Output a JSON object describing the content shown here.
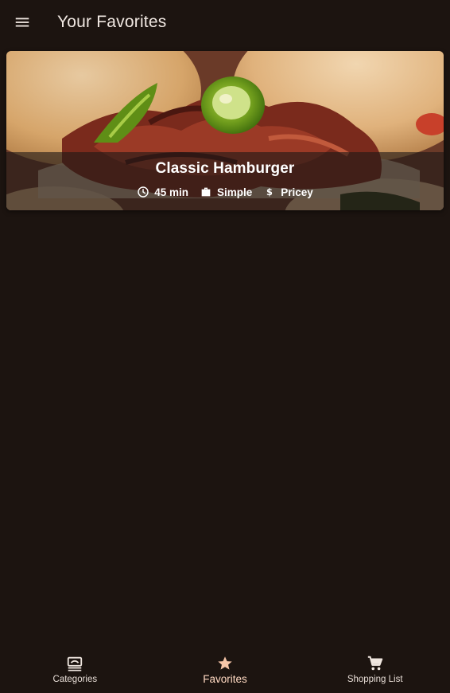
{
  "app_bar": {
    "title": "Your Favorites",
    "menu_icon": "menu-icon"
  },
  "meals": [
    {
      "title": "Classic Hamburger",
      "duration": "45 min",
      "complexity": "Simple",
      "affordability": "Pricey",
      "icons": {
        "duration": "clock-icon",
        "complexity": "work-icon",
        "affordability": "dollar-icon"
      }
    }
  ],
  "bottom_nav": {
    "tabs": [
      {
        "label": "Categories",
        "icon": "dinner-set-icon",
        "active": false
      },
      {
        "label": "Favorites",
        "icon": "star-icon",
        "active": true
      },
      {
        "label": "Shopping List",
        "icon": "cart-icon",
        "active": false
      }
    ]
  },
  "colors": {
    "background": "#1c1410",
    "active_tab": "#ffd9c2",
    "text": "#f3ece6"
  }
}
